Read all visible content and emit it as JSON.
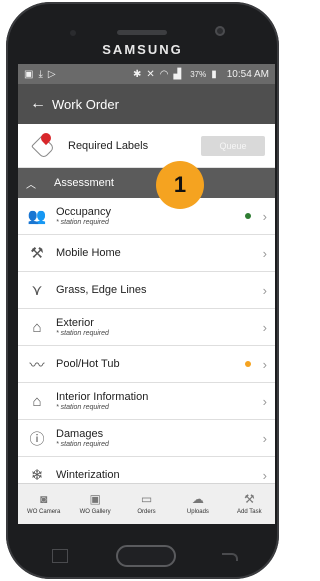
{
  "device": {
    "brand": "SAMSUNG"
  },
  "status_bar": {
    "battery": "37%",
    "time": "10:54 AM"
  },
  "app_bar": {
    "title": "Work Order"
  },
  "required_labels": {
    "label": "Required Labels",
    "queue_button": "Queue"
  },
  "section": {
    "title": "Assessment",
    "badge": "1"
  },
  "items": [
    {
      "name": "Occupancy",
      "sub": "* station required",
      "icon": "person-icon",
      "dot": "#2e7d32"
    },
    {
      "name": "Mobile Home",
      "sub": "",
      "icon": "tools-icon",
      "dot": ""
    },
    {
      "name": "Grass, Edge Lines",
      "sub": "",
      "icon": "grass-icon",
      "dot": ""
    },
    {
      "name": "Exterior",
      "sub": "* station required",
      "icon": "house-icon",
      "dot": ""
    },
    {
      "name": "Pool/Hot Tub",
      "sub": "",
      "icon": "pool-icon",
      "dot": "#f5a320"
    },
    {
      "name": "Interior Information",
      "sub": "* station required",
      "icon": "interior-icon",
      "dot": ""
    },
    {
      "name": "Damages",
      "sub": "* station required",
      "icon": "warning-icon",
      "dot": ""
    },
    {
      "name": "Winterization",
      "sub": "",
      "icon": "snowflake-icon",
      "dot": ""
    }
  ],
  "bottom_nav": [
    {
      "label": "WO Camera",
      "icon": "camera-icon"
    },
    {
      "label": "WO Gallery",
      "icon": "gallery-icon"
    },
    {
      "label": "Orders",
      "icon": "folder-icon"
    },
    {
      "label": "Uploads",
      "icon": "cloud-upload-icon"
    },
    {
      "label": "Add Task",
      "icon": "add-task-icon"
    }
  ]
}
